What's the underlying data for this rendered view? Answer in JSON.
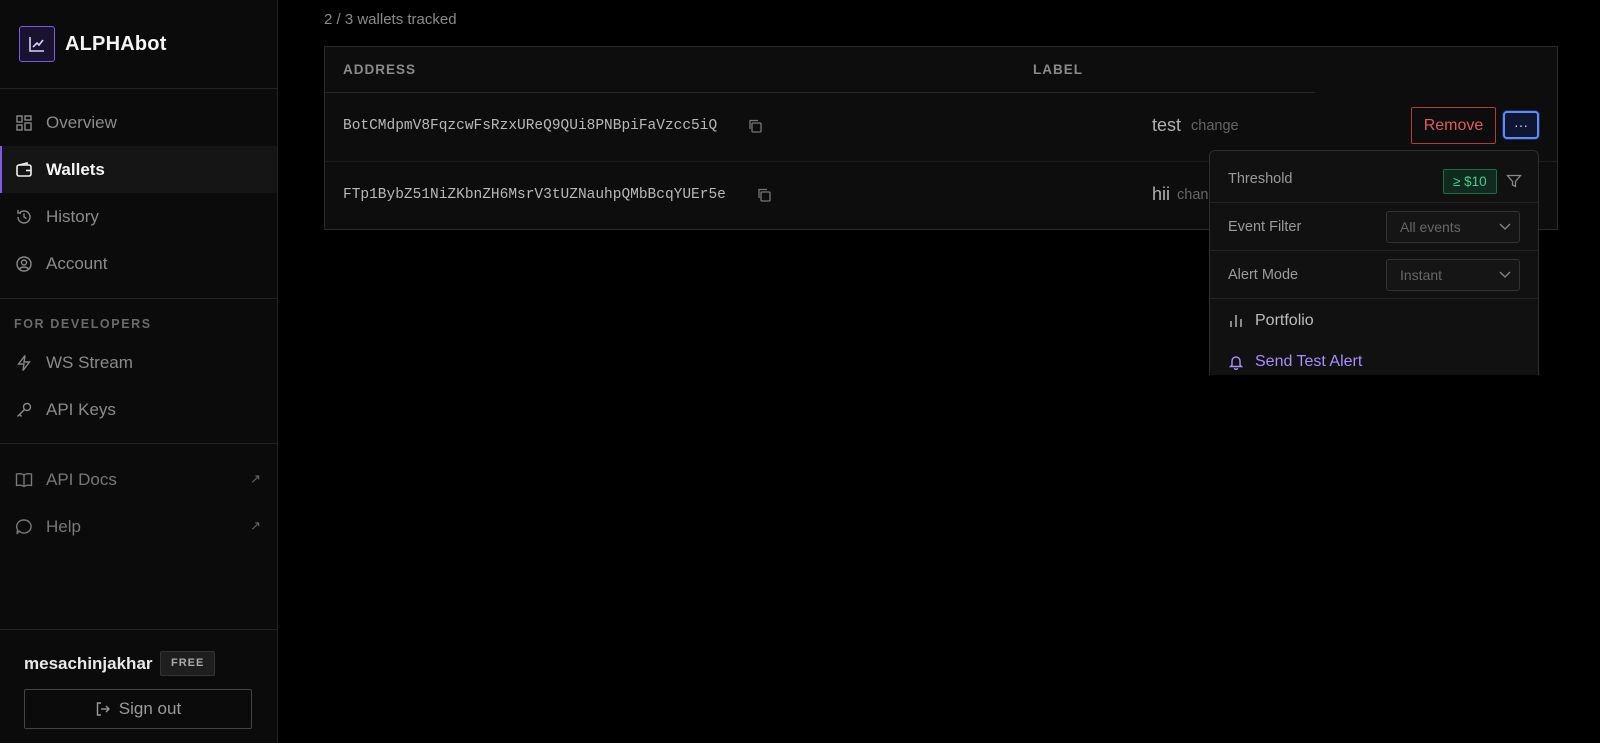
{
  "app": {
    "name": "ALPHAbot"
  },
  "sidebar": {
    "nav": [
      {
        "label": "Overview",
        "icon": "grid-icon",
        "active": false
      },
      {
        "label": "Wallets",
        "icon": "wallet-icon",
        "active": true
      },
      {
        "label": "History",
        "icon": "history-icon",
        "active": false
      },
      {
        "label": "Account",
        "icon": "user-circle-icon",
        "active": false
      }
    ],
    "developers_label": "FOR DEVELOPERS",
    "dev_nav": [
      {
        "label": "WS Stream",
        "icon": "bolt-icon"
      },
      {
        "label": "API Keys",
        "icon": "key-icon"
      }
    ],
    "docs_nav": [
      {
        "label": "API Docs",
        "icon": "book-icon",
        "external": "↗"
      },
      {
        "label": "Help",
        "icon": "chat-icon",
        "external": "↗"
      }
    ],
    "user": {
      "name": "mesachinjakhar",
      "plan": "FREE"
    },
    "signout_label": "Sign out"
  },
  "main": {
    "count_text": "2 / 3 wallets tracked",
    "table": {
      "headers": {
        "address": "ADDRESS",
        "label": "LABEL"
      },
      "rows": [
        {
          "address": "BotCMdpmV8FqzcwFsRzxUReQ9QUi8PNBpiFaVzcc5iQ",
          "label": "test",
          "change": "change"
        },
        {
          "address": "FTp1BybZ51NiZKbnZH6MsrV3tUZNauhpQMbBcqYUEr5e",
          "label": "hii",
          "change": "chan"
        }
      ]
    },
    "remove_label": "Remove",
    "more_label": "···"
  },
  "menu": {
    "threshold_label": "Threshold",
    "threshold_value": "≥ $10",
    "event_filter_label": "Event Filter",
    "event_filter_value": "All events",
    "alert_mode_label": "Alert Mode",
    "alert_mode_value": "Instant",
    "portfolio_label": "Portfolio",
    "test_alert_label": "Send Test Alert"
  },
  "colors": {
    "accent": "#7c5ce6",
    "danger": "#e25a5a",
    "success": "#3fcf8a",
    "focus": "#5b8cff",
    "link": "#a98cff"
  }
}
